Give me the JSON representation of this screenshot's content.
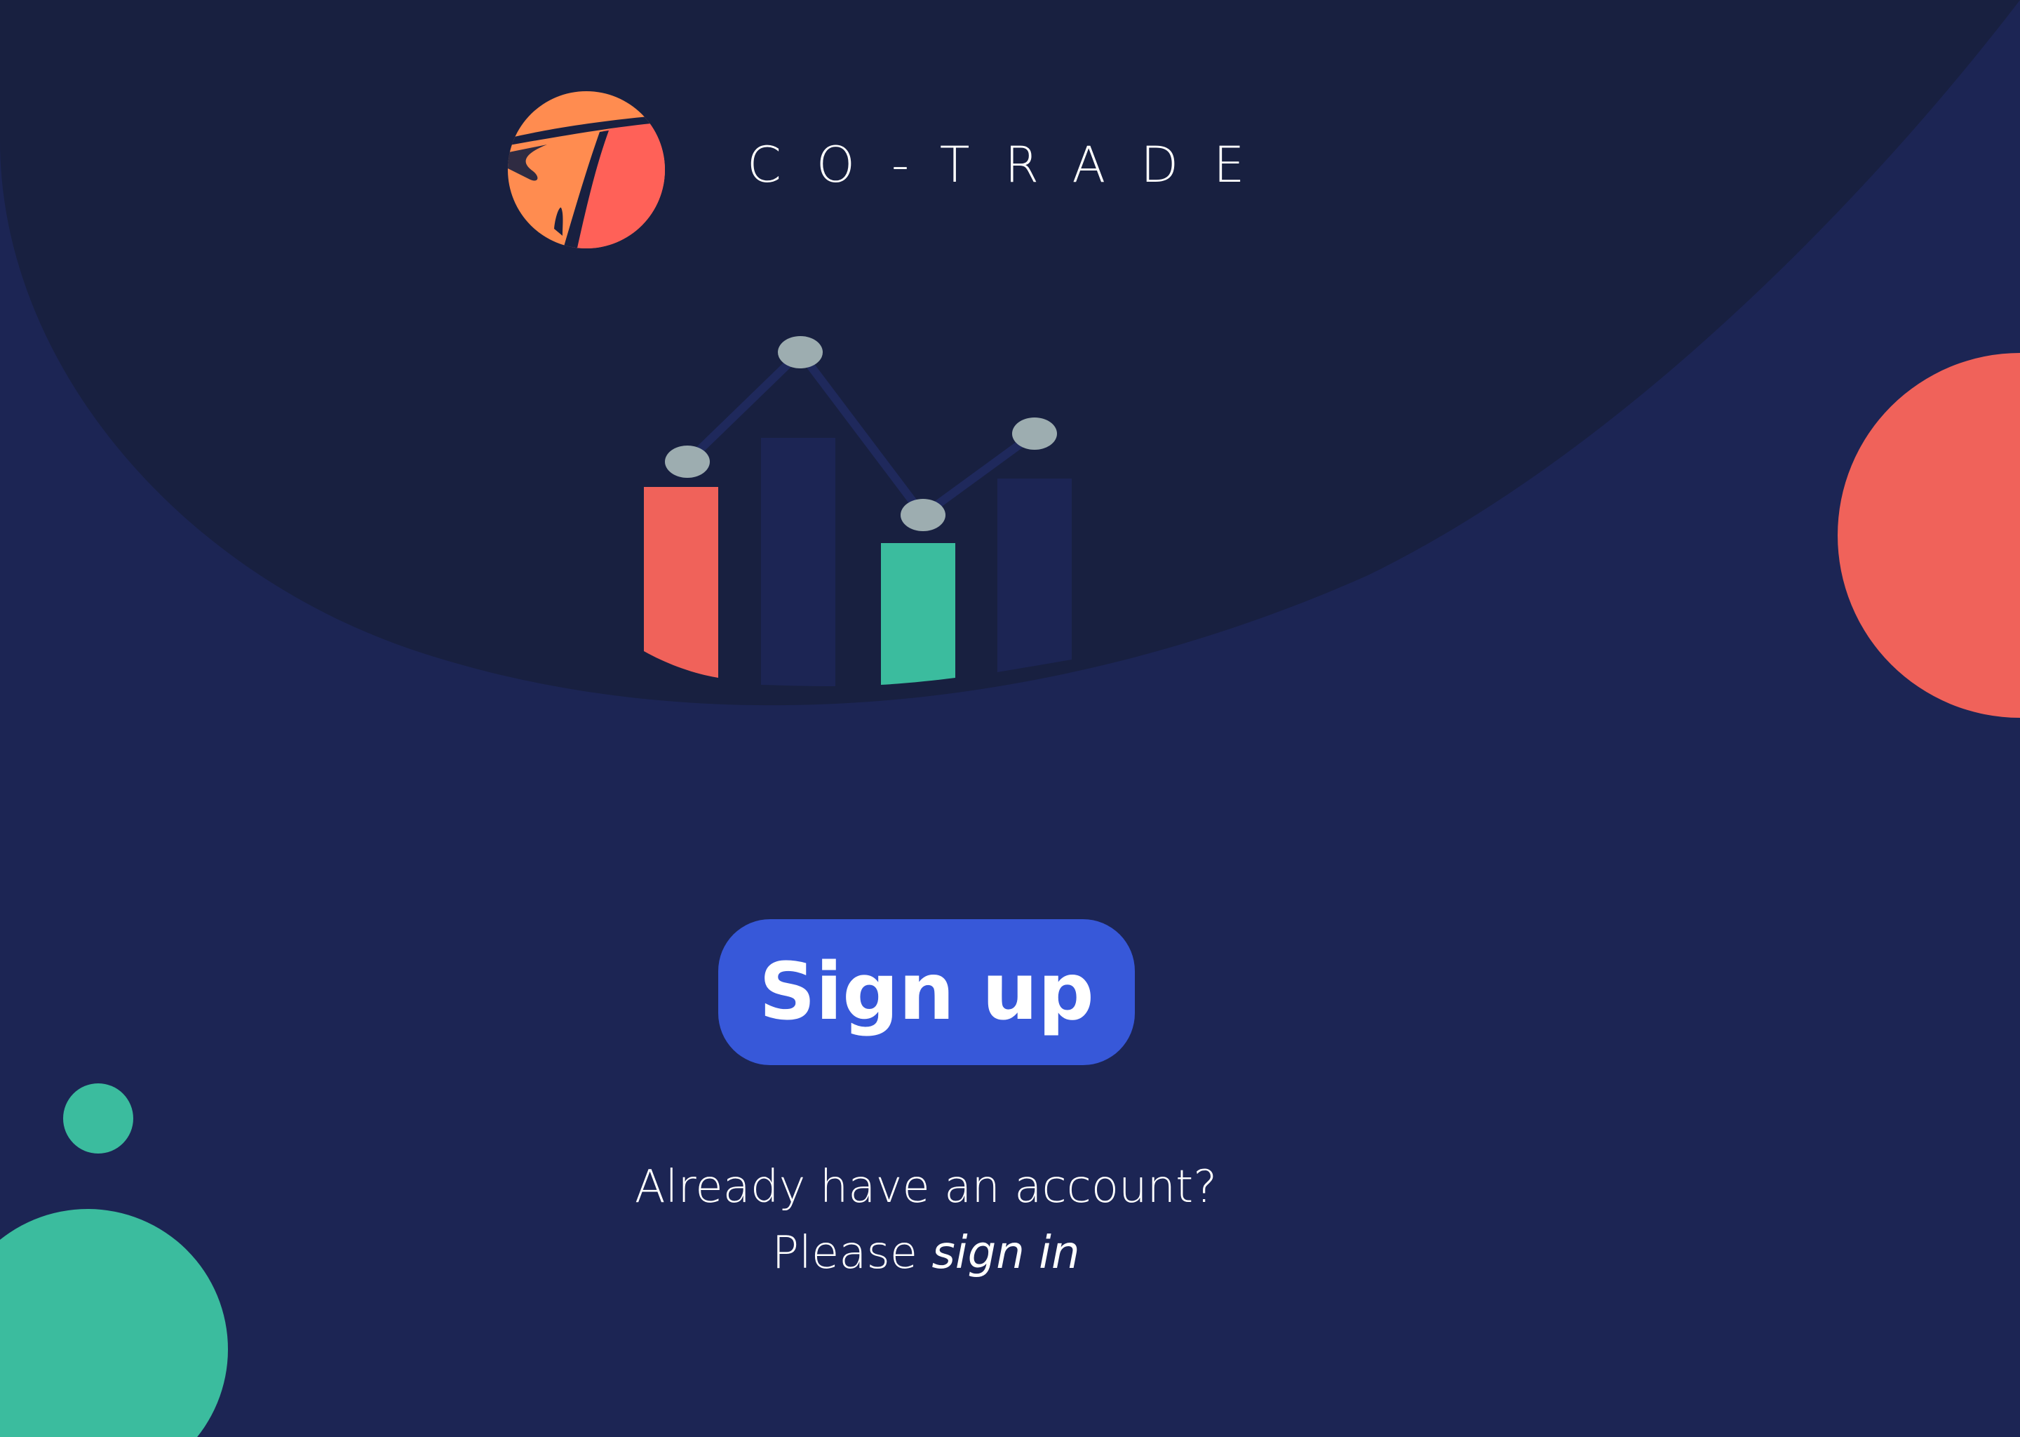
{
  "brand": {
    "name": "CO-TRADE",
    "logo_icon": "cotrade-logo-icon"
  },
  "illustration": {
    "icon": "bar-line-chart-illustration"
  },
  "actions": {
    "signup_label": "Sign up"
  },
  "signin_prompt": {
    "question": "Already have an account?",
    "please": "Please ",
    "link_label": "sign in"
  },
  "colors": {
    "background": "#1c2554",
    "top_blob": "#182040",
    "coral": "#f0625a",
    "teal": "#3bbc9e",
    "button": "#3758d9",
    "logo_orange": "#ff8c50",
    "logo_red": "#ff6158",
    "marker": "#9dadb0"
  }
}
